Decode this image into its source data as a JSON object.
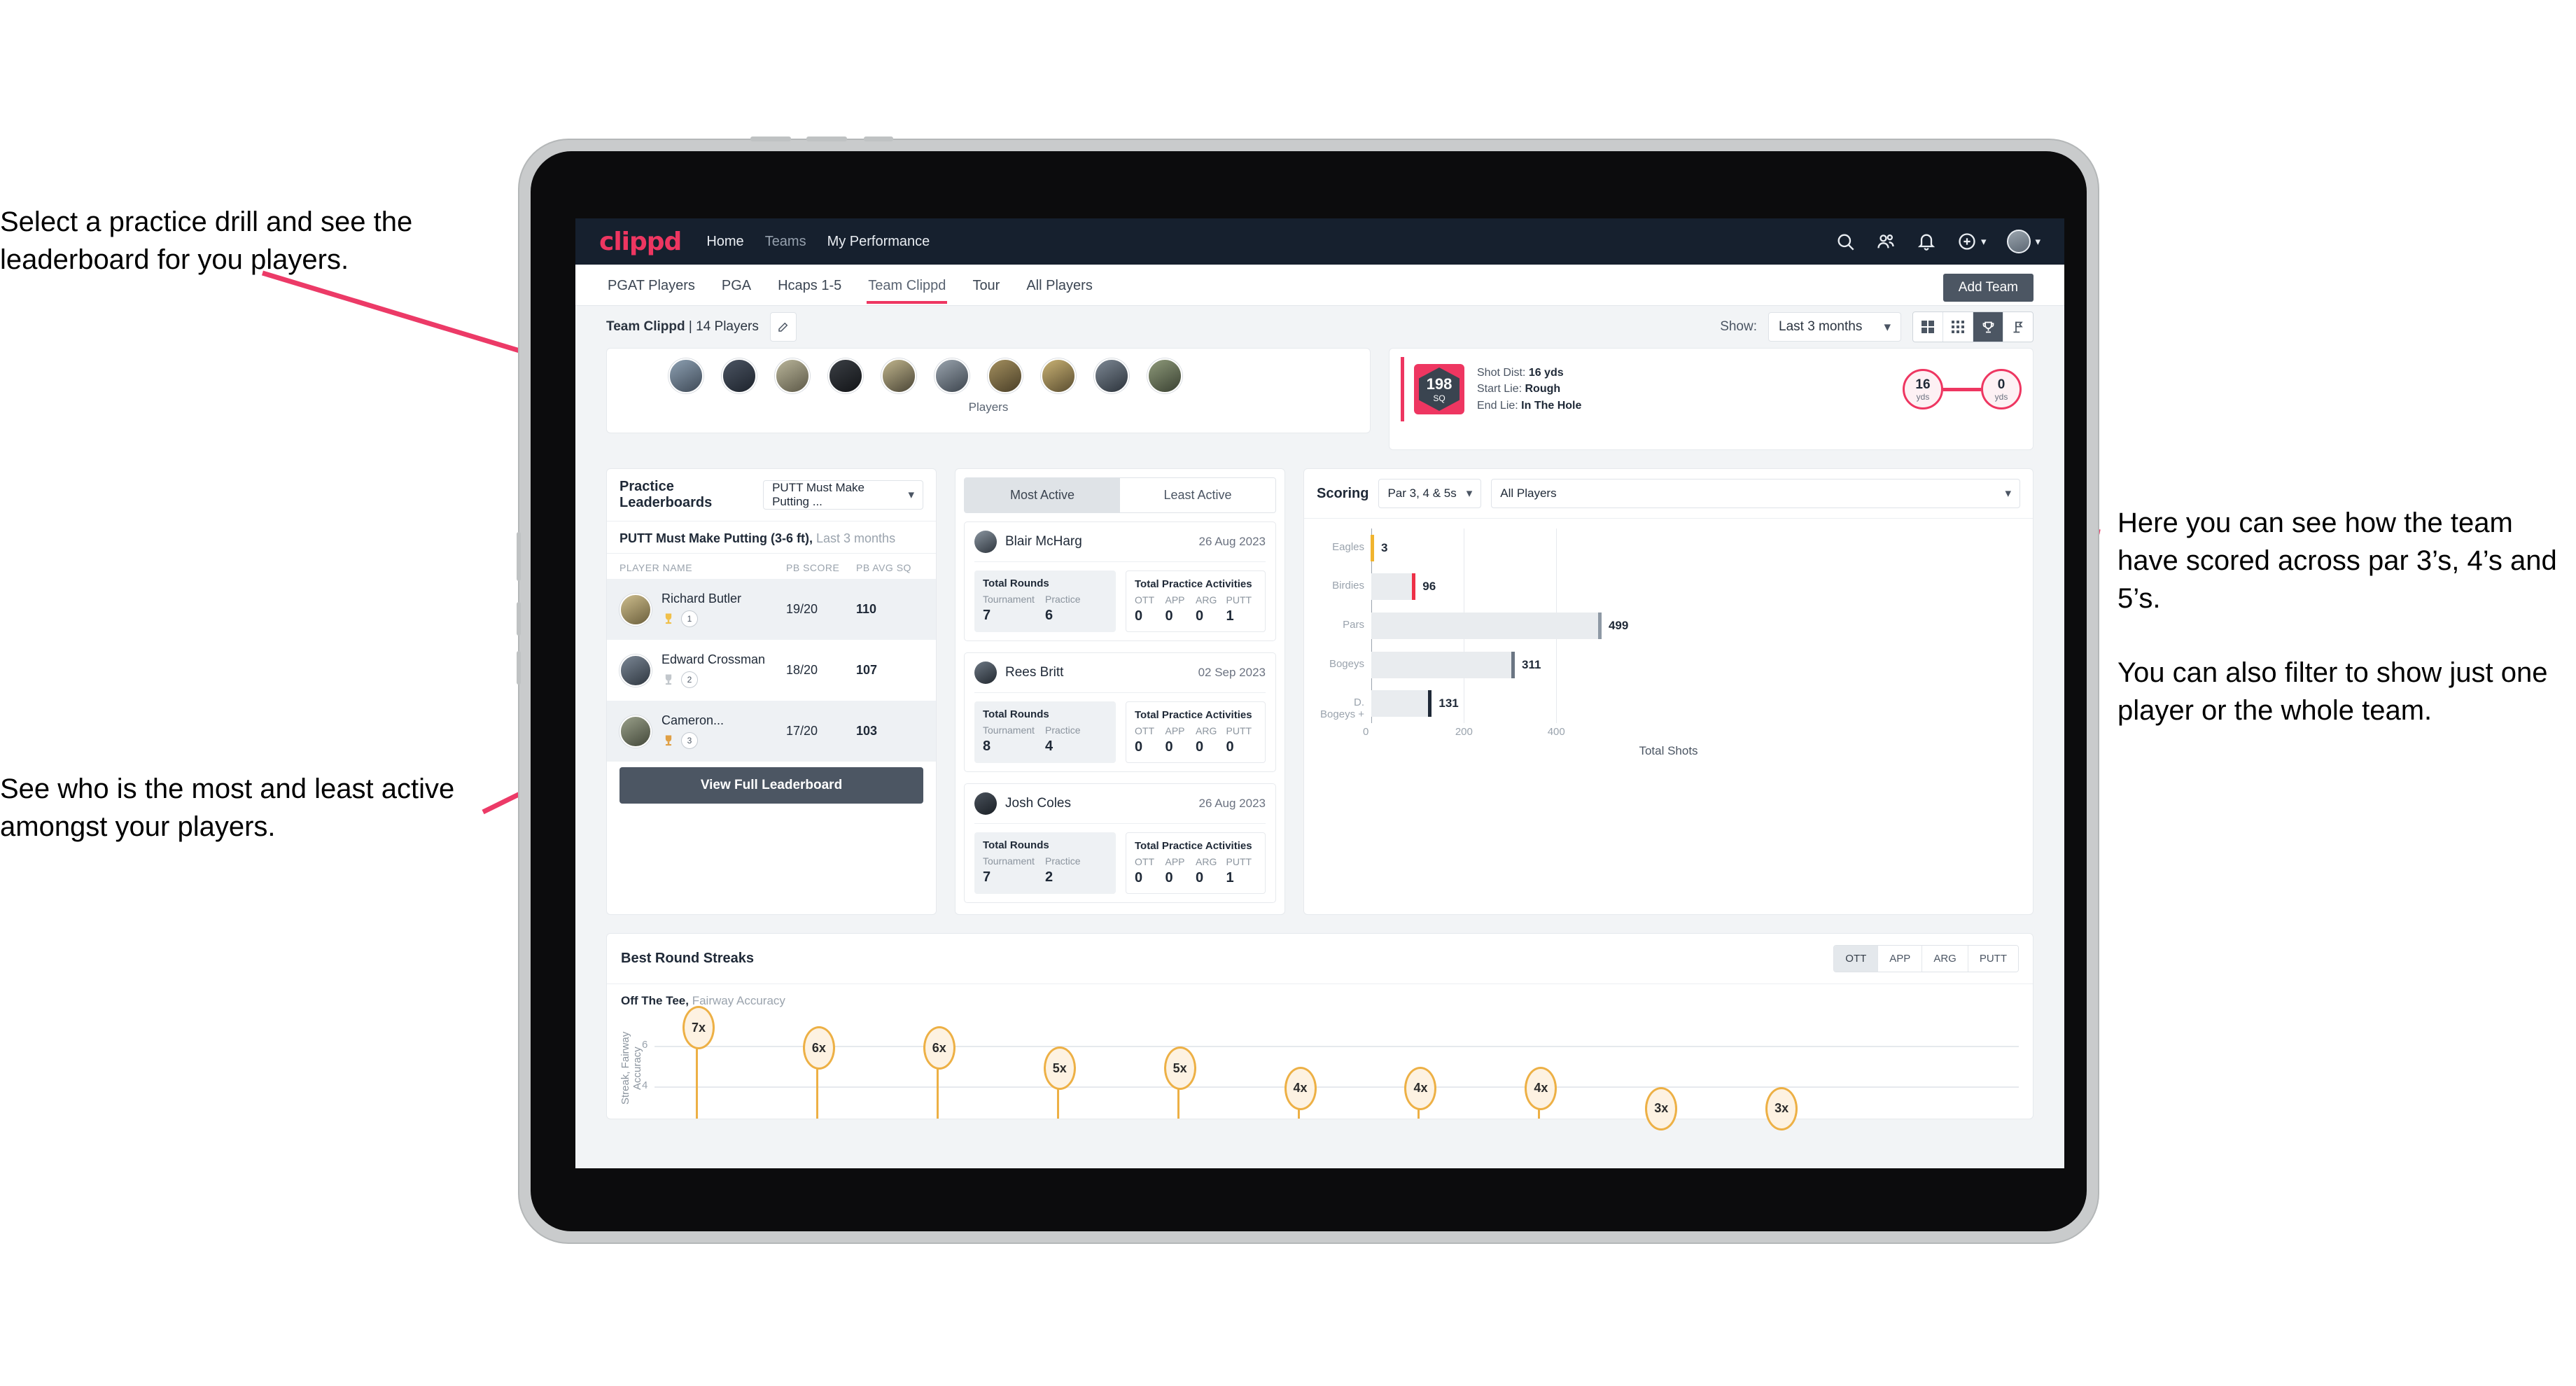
{
  "annotations": {
    "left_top": "Select a practice drill and see the leaderboard for you players.",
    "left_bottom": "See who is the most and least active amongst your players.",
    "right_p1": "Here you can see how the team have scored across par 3’s, 4’s and 5’s.",
    "right_p2": "You can also filter to show just one player or the whole team.",
    "arrow_color": "#ec3a67"
  },
  "app": {
    "logo": "clippd",
    "nav": [
      {
        "label": "Home",
        "active": true
      },
      {
        "label": "Teams",
        "active": false
      },
      {
        "label": "My Performance",
        "active": true
      }
    ],
    "icons": {
      "search": "search-icon",
      "people": "people-icon",
      "bell": "bell-icon",
      "plus": "plus-circle-icon",
      "avatar": "user-avatar"
    },
    "brand_color": "#ee3661",
    "header_bg": "#16202e"
  },
  "tabs": {
    "items": [
      "PGAT Players",
      "PGA",
      "Hcaps 1-5",
      "Team Clippd",
      "Tour",
      "All Players"
    ],
    "active": "Team Clippd",
    "add_team_label": "Add Team"
  },
  "filterbar": {
    "team_name": "Team Clippd",
    "team_players": "| 14 Players",
    "edit_icon": "pencil-icon",
    "show_label": "Show:",
    "period_value": "Last 3 months",
    "view_buttons": [
      {
        "name": "grid-large-icon",
        "active": false
      },
      {
        "name": "grid-small-icon",
        "active": false
      },
      {
        "name": "trophy-icon",
        "active": true
      },
      {
        "name": "flag-icon",
        "active": false
      }
    ]
  },
  "players_card": {
    "caption": "Players",
    "avatar_count": 10
  },
  "shot_card": {
    "hex_value": "198",
    "hex_unit": "SQ",
    "rows": [
      {
        "label": "Shot Dist:",
        "value": "16 yds"
      },
      {
        "label": "Start Lie:",
        "value": "Rough"
      },
      {
        "label": "End Lie:",
        "value": "In The Hole"
      }
    ],
    "start_dot": {
      "value": "16",
      "unit": "yds"
    },
    "end_dot": {
      "value": "0",
      "unit": "yds"
    }
  },
  "leaderboard": {
    "title": "Practice Leaderboards",
    "drill_select": "PUTT Must Make Putting ...",
    "subtitle_bold": "PUTT Must Make Putting (3-6 ft),",
    "subtitle_light": " Last 3 months",
    "columns": [
      "PLAYER NAME",
      "PB SCORE",
      "PB AVG SQ"
    ],
    "rows": [
      {
        "name": "Richard Butler",
        "rank": "1",
        "trophy": "gold",
        "pb_score": "19/20",
        "pb_avg_sq": "110"
      },
      {
        "name": "Edward Crossman",
        "rank": "2",
        "trophy": "silver",
        "pb_score": "18/20",
        "pb_avg_sq": "107"
      },
      {
        "name": "Cameron...",
        "rank": "3",
        "trophy": "bronze",
        "pb_score": "17/20",
        "pb_avg_sq": "103"
      }
    ],
    "button_label": "View Full Leaderboard"
  },
  "activity": {
    "tabs": [
      {
        "label": "Most Active",
        "active": true
      },
      {
        "label": "Least Active",
        "active": false
      }
    ],
    "rounds_title": "Total Rounds",
    "rounds_cols": [
      "Tournament",
      "Practice"
    ],
    "practice_title": "Total Practice Activities",
    "practice_cols": [
      "OTT",
      "APP",
      "ARG",
      "PUTT"
    ],
    "items": [
      {
        "name": "Blair McHarg",
        "date": "26 Aug 2023",
        "tournament": "7",
        "practice": "6",
        "ott": "0",
        "app": "0",
        "arg": "0",
        "putt": "1"
      },
      {
        "name": "Rees Britt",
        "date": "02 Sep 2023",
        "tournament": "8",
        "practice": "4",
        "ott": "0",
        "app": "0",
        "arg": "0",
        "putt": "0"
      },
      {
        "name": "Josh Coles",
        "date": "26 Aug 2023",
        "tournament": "7",
        "practice": "2",
        "ott": "0",
        "app": "0",
        "arg": "0",
        "putt": "1"
      }
    ]
  },
  "scoring": {
    "title": "Scoring",
    "par_select": "Par 3, 4 & 5s",
    "player_select": "All Players"
  },
  "streaks": {
    "title": "Best Round Streaks",
    "segments": [
      {
        "label": "OTT",
        "active": true
      },
      {
        "label": "APP",
        "active": false
      },
      {
        "label": "ARG",
        "active": false
      },
      {
        "label": "PUTT",
        "active": false
      }
    ],
    "sub_bold": "Off The Tee,",
    "sub_light": " Fairway Accuracy"
  },
  "chart_data": [
    {
      "type": "bar",
      "title": "Scoring",
      "orientation": "horizontal",
      "categories": [
        "Eagles",
        "Birdies",
        "Pars",
        "Bogeys",
        "D. Bogeys +"
      ],
      "values": [
        3,
        96,
        499,
        311,
        131
      ],
      "cap_colors": [
        "#f0b42e",
        "#ee3047",
        "#8e99a5",
        "#6b7683",
        "#1f2937"
      ],
      "xlabel": "Total Shots",
      "ylabel": "",
      "xticks": [
        0,
        200,
        400
      ],
      "xlim": [
        0,
        540
      ],
      "grid": true,
      "legend": "none"
    },
    {
      "type": "scatter",
      "title": "Off The Tee, Fairway Accuracy",
      "ylabel": "Streak, Fairway Accuracy",
      "xlabel": "",
      "yticks": [
        4,
        6
      ],
      "ylim": [
        2.4,
        7.6
      ],
      "values": [
        7,
        6,
        6,
        5,
        5,
        4,
        4,
        4,
        3,
        3
      ],
      "labels": [
        "7x",
        "6x",
        "6x",
        "5x",
        "5x",
        "4x",
        "4x",
        "4x",
        "3x",
        "3x"
      ],
      "marker_color": "#edb045",
      "marker_fill": "#fdf2e2",
      "grid": true
    }
  ]
}
